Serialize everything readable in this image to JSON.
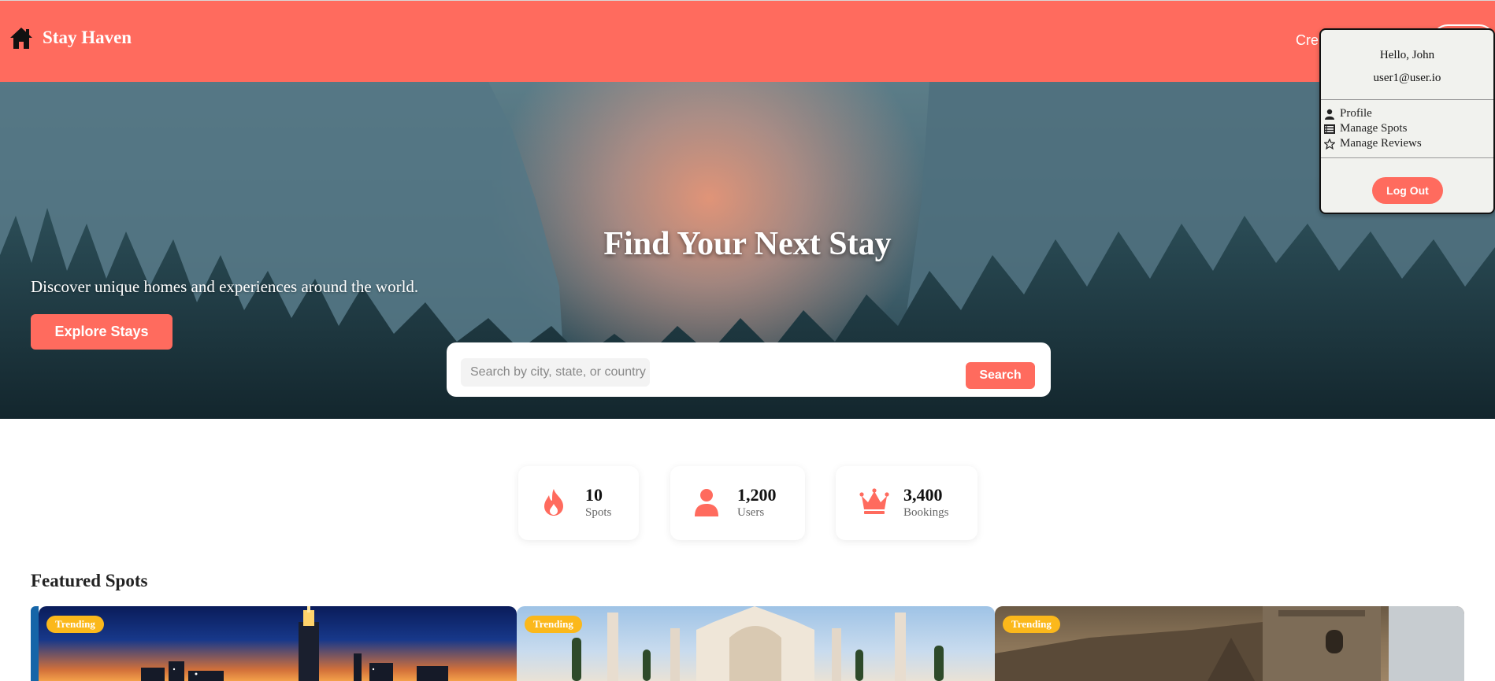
{
  "header": {
    "brand": "Stay Haven",
    "create_link": "Cre",
    "colors": {
      "primary": "#ff6b5e",
      "badge": "#fbb81b"
    }
  },
  "hero": {
    "title": "Find Your Next Stay",
    "subtitle": "Discover unique homes and experiences around the world.",
    "cta_label": "Explore Stays",
    "search": {
      "placeholder": "Search by city, state, or country",
      "button_label": "Search"
    }
  },
  "dropdown": {
    "greeting": "Hello, John",
    "email": "user1@user.io",
    "items": [
      {
        "label": "Profile",
        "icon": "user-icon"
      },
      {
        "label": "Manage Spots",
        "icon": "list-icon"
      },
      {
        "label": "Manage Reviews",
        "icon": "star-icon"
      }
    ],
    "logout_label": "Log Out"
  },
  "stats": [
    {
      "value": "10",
      "label": "Spots",
      "icon": "fire-icon"
    },
    {
      "value": "1,200",
      "label": "Users",
      "icon": "user-icon"
    },
    {
      "value": "3,400",
      "label": "Bookings",
      "icon": "crown-icon"
    }
  ],
  "featured": {
    "title": "Featured Spots",
    "cards": [
      {
        "badge": "Trending",
        "scene": "city-skyline-night"
      },
      {
        "badge": "Trending",
        "scene": "taj-mahal"
      },
      {
        "badge": "Trending",
        "scene": "great-wall"
      }
    ]
  }
}
